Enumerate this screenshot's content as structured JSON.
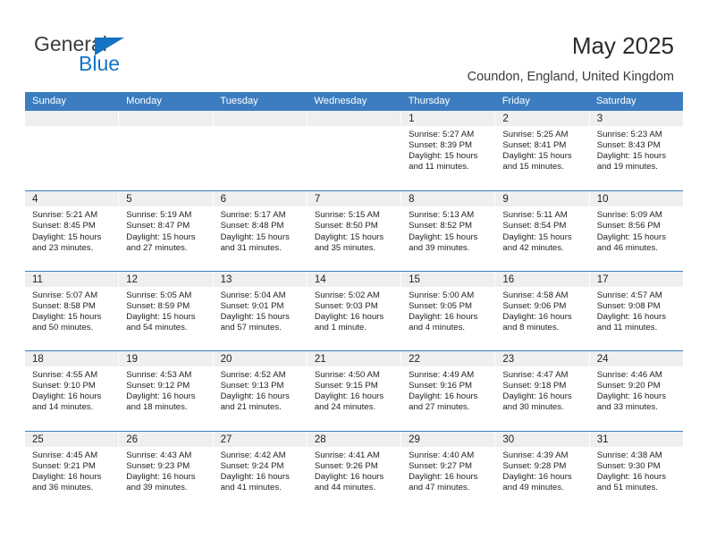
{
  "brand": {
    "line1": "General",
    "line2": "Blue",
    "triangle_color": "#1673c4",
    "text_color": "#3c3c3c"
  },
  "header": {
    "title": "May 2025",
    "location": "Coundon, England, United Kingdom",
    "accent_color": "#3b7dc0"
  },
  "calendar": {
    "weekday_headers": [
      "Sunday",
      "Monday",
      "Tuesday",
      "Wednesday",
      "Thursday",
      "Friday",
      "Saturday"
    ],
    "weeks": [
      [
        {
          "day": "",
          "empty": true
        },
        {
          "day": "",
          "empty": true
        },
        {
          "day": "",
          "empty": true
        },
        {
          "day": "",
          "empty": true
        },
        {
          "day": "1",
          "sunrise": "Sunrise: 5:27 AM",
          "sunset": "Sunset: 8:39 PM",
          "daylight_1": "Daylight: 15 hours",
          "daylight_2": "and 11 minutes."
        },
        {
          "day": "2",
          "sunrise": "Sunrise: 5:25 AM",
          "sunset": "Sunset: 8:41 PM",
          "daylight_1": "Daylight: 15 hours",
          "daylight_2": "and 15 minutes."
        },
        {
          "day": "3",
          "sunrise": "Sunrise: 5:23 AM",
          "sunset": "Sunset: 8:43 PM",
          "daylight_1": "Daylight: 15 hours",
          "daylight_2": "and 19 minutes."
        }
      ],
      [
        {
          "day": "4",
          "sunrise": "Sunrise: 5:21 AM",
          "sunset": "Sunset: 8:45 PM",
          "daylight_1": "Daylight: 15 hours",
          "daylight_2": "and 23 minutes."
        },
        {
          "day": "5",
          "sunrise": "Sunrise: 5:19 AM",
          "sunset": "Sunset: 8:47 PM",
          "daylight_1": "Daylight: 15 hours",
          "daylight_2": "and 27 minutes."
        },
        {
          "day": "6",
          "sunrise": "Sunrise: 5:17 AM",
          "sunset": "Sunset: 8:48 PM",
          "daylight_1": "Daylight: 15 hours",
          "daylight_2": "and 31 minutes."
        },
        {
          "day": "7",
          "sunrise": "Sunrise: 5:15 AM",
          "sunset": "Sunset: 8:50 PM",
          "daylight_1": "Daylight: 15 hours",
          "daylight_2": "and 35 minutes."
        },
        {
          "day": "8",
          "sunrise": "Sunrise: 5:13 AM",
          "sunset": "Sunset: 8:52 PM",
          "daylight_1": "Daylight: 15 hours",
          "daylight_2": "and 39 minutes."
        },
        {
          "day": "9",
          "sunrise": "Sunrise: 5:11 AM",
          "sunset": "Sunset: 8:54 PM",
          "daylight_1": "Daylight: 15 hours",
          "daylight_2": "and 42 minutes."
        },
        {
          "day": "10",
          "sunrise": "Sunrise: 5:09 AM",
          "sunset": "Sunset: 8:56 PM",
          "daylight_1": "Daylight: 15 hours",
          "daylight_2": "and 46 minutes."
        }
      ],
      [
        {
          "day": "11",
          "sunrise": "Sunrise: 5:07 AM",
          "sunset": "Sunset: 8:58 PM",
          "daylight_1": "Daylight: 15 hours",
          "daylight_2": "and 50 minutes."
        },
        {
          "day": "12",
          "sunrise": "Sunrise: 5:05 AM",
          "sunset": "Sunset: 8:59 PM",
          "daylight_1": "Daylight: 15 hours",
          "daylight_2": "and 54 minutes."
        },
        {
          "day": "13",
          "sunrise": "Sunrise: 5:04 AM",
          "sunset": "Sunset: 9:01 PM",
          "daylight_1": "Daylight: 15 hours",
          "daylight_2": "and 57 minutes."
        },
        {
          "day": "14",
          "sunrise": "Sunrise: 5:02 AM",
          "sunset": "Sunset: 9:03 PM",
          "daylight_1": "Daylight: 16 hours",
          "daylight_2": "and 1 minute."
        },
        {
          "day": "15",
          "sunrise": "Sunrise: 5:00 AM",
          "sunset": "Sunset: 9:05 PM",
          "daylight_1": "Daylight: 16 hours",
          "daylight_2": "and 4 minutes."
        },
        {
          "day": "16",
          "sunrise": "Sunrise: 4:58 AM",
          "sunset": "Sunset: 9:06 PM",
          "daylight_1": "Daylight: 16 hours",
          "daylight_2": "and 8 minutes."
        },
        {
          "day": "17",
          "sunrise": "Sunrise: 4:57 AM",
          "sunset": "Sunset: 9:08 PM",
          "daylight_1": "Daylight: 16 hours",
          "daylight_2": "and 11 minutes."
        }
      ],
      [
        {
          "day": "18",
          "sunrise": "Sunrise: 4:55 AM",
          "sunset": "Sunset: 9:10 PM",
          "daylight_1": "Daylight: 16 hours",
          "daylight_2": "and 14 minutes."
        },
        {
          "day": "19",
          "sunrise": "Sunrise: 4:53 AM",
          "sunset": "Sunset: 9:12 PM",
          "daylight_1": "Daylight: 16 hours",
          "daylight_2": "and 18 minutes."
        },
        {
          "day": "20",
          "sunrise": "Sunrise: 4:52 AM",
          "sunset": "Sunset: 9:13 PM",
          "daylight_1": "Daylight: 16 hours",
          "daylight_2": "and 21 minutes."
        },
        {
          "day": "21",
          "sunrise": "Sunrise: 4:50 AM",
          "sunset": "Sunset: 9:15 PM",
          "daylight_1": "Daylight: 16 hours",
          "daylight_2": "and 24 minutes."
        },
        {
          "day": "22",
          "sunrise": "Sunrise: 4:49 AM",
          "sunset": "Sunset: 9:16 PM",
          "daylight_1": "Daylight: 16 hours",
          "daylight_2": "and 27 minutes."
        },
        {
          "day": "23",
          "sunrise": "Sunrise: 4:47 AM",
          "sunset": "Sunset: 9:18 PM",
          "daylight_1": "Daylight: 16 hours",
          "daylight_2": "and 30 minutes."
        },
        {
          "day": "24",
          "sunrise": "Sunrise: 4:46 AM",
          "sunset": "Sunset: 9:20 PM",
          "daylight_1": "Daylight: 16 hours",
          "daylight_2": "and 33 minutes."
        }
      ],
      [
        {
          "day": "25",
          "sunrise": "Sunrise: 4:45 AM",
          "sunset": "Sunset: 9:21 PM",
          "daylight_1": "Daylight: 16 hours",
          "daylight_2": "and 36 minutes."
        },
        {
          "day": "26",
          "sunrise": "Sunrise: 4:43 AM",
          "sunset": "Sunset: 9:23 PM",
          "daylight_1": "Daylight: 16 hours",
          "daylight_2": "and 39 minutes."
        },
        {
          "day": "27",
          "sunrise": "Sunrise: 4:42 AM",
          "sunset": "Sunset: 9:24 PM",
          "daylight_1": "Daylight: 16 hours",
          "daylight_2": "and 41 minutes."
        },
        {
          "day": "28",
          "sunrise": "Sunrise: 4:41 AM",
          "sunset": "Sunset: 9:26 PM",
          "daylight_1": "Daylight: 16 hours",
          "daylight_2": "and 44 minutes."
        },
        {
          "day": "29",
          "sunrise": "Sunrise: 4:40 AM",
          "sunset": "Sunset: 9:27 PM",
          "daylight_1": "Daylight: 16 hours",
          "daylight_2": "and 47 minutes."
        },
        {
          "day": "30",
          "sunrise": "Sunrise: 4:39 AM",
          "sunset": "Sunset: 9:28 PM",
          "daylight_1": "Daylight: 16 hours",
          "daylight_2": "and 49 minutes."
        },
        {
          "day": "31",
          "sunrise": "Sunrise: 4:38 AM",
          "sunset": "Sunset: 9:30 PM",
          "daylight_1": "Daylight: 16 hours",
          "daylight_2": "and 51 minutes."
        }
      ]
    ]
  }
}
